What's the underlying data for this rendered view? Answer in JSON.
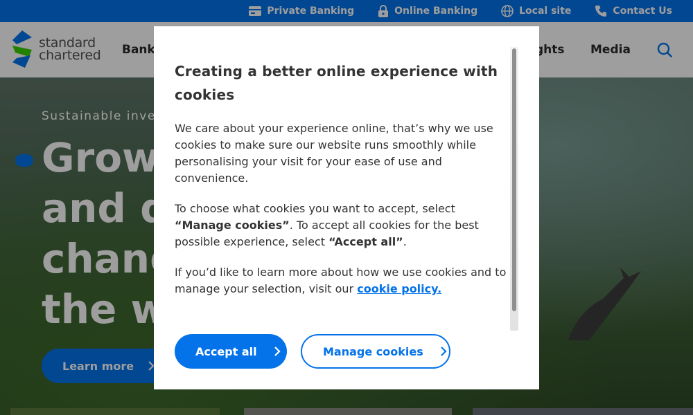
{
  "utility_bar": {
    "links": [
      {
        "label": "Private Banking",
        "icon": "card-icon"
      },
      {
        "label": "Online Banking",
        "icon": "lock-icon"
      },
      {
        "label": "Local site",
        "icon": "globe-icon"
      },
      {
        "label": "Contact Us",
        "icon": "phone-icon"
      }
    ]
  },
  "header": {
    "logo_line1": "standard",
    "logo_line2": "chartered",
    "nav": [
      "Banki",
      "ghts",
      "Media"
    ]
  },
  "hero": {
    "eyebrow": "Sustainable inves",
    "headline": [
      "Grow y",
      "and d",
      "chang",
      "the wo"
    ],
    "cta": "Learn more"
  },
  "cookie_modal": {
    "title": "Creating a better online experience with cookies",
    "p1": "We care about your experience online, that’s why we use cookies to make sure our website runs smoothly while personalising your visit for your ease of use and convenience.",
    "p2_a": "To choose what cookies you want to accept, select ",
    "p2_b": "“Manage cookies”",
    "p2_c": ". To accept all cookies for the best possible experience, select ",
    "p2_d": "“Accept all”",
    "p2_e": ".",
    "p3_a": "If you’d like to learn more about how we use cookies and to manage your selection, visit our ",
    "p3_link": "cookie policy.",
    "accept_label": "Accept all",
    "manage_label": "Manage cookies"
  },
  "colors": {
    "brand_blue": "#0473ea",
    "brand_green": "#38d200"
  }
}
